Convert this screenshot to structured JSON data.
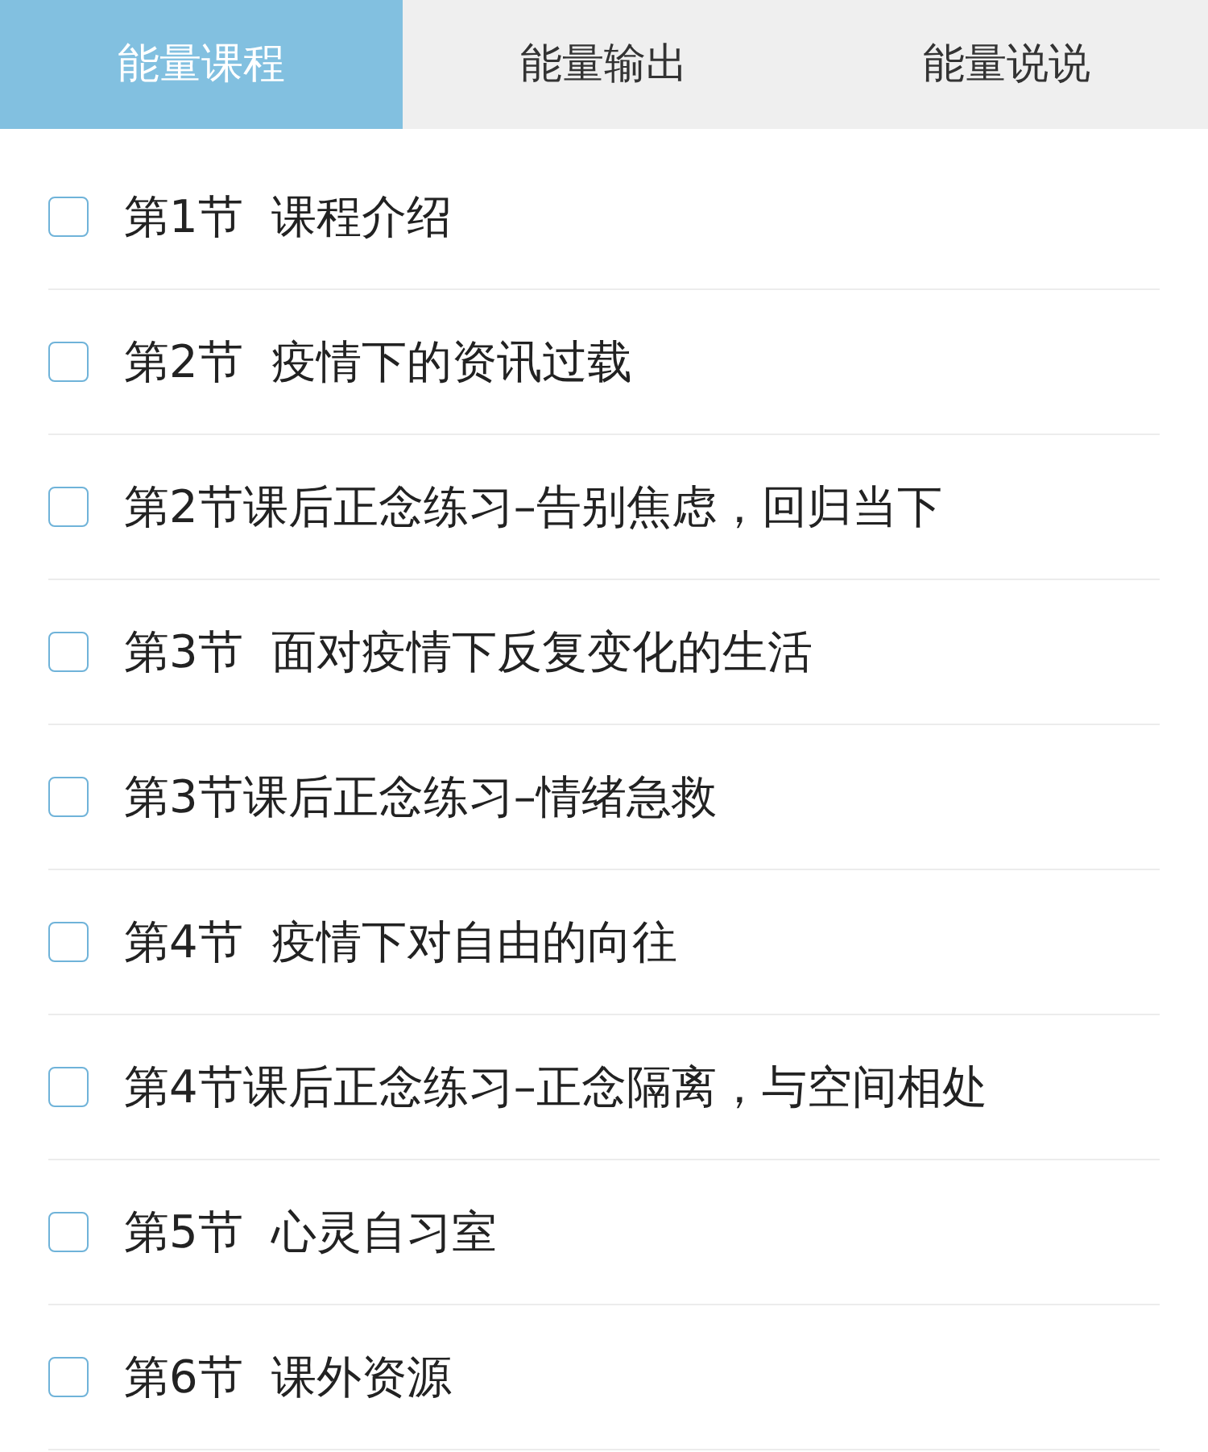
{
  "tabs": [
    {
      "label": "能量课程",
      "selected": true
    },
    {
      "label": "能量输出",
      "selected": false
    },
    {
      "label": "能量说说",
      "selected": false
    }
  ],
  "items": [
    {
      "label": "第1节  课程介绍",
      "checked": false
    },
    {
      "label": "第2节  疫情下的资讯过载",
      "checked": false
    },
    {
      "label": "第2节课后正念练习–告别焦虑，回归当下",
      "checked": false
    },
    {
      "label": "第3节  面对疫情下反复变化的生活",
      "checked": false
    },
    {
      "label": "第3节课后正念练习–情绪急救",
      "checked": false
    },
    {
      "label": "第4节  疫情下对自由的向往",
      "checked": false
    },
    {
      "label": "第4节课后正念练习–正念隔离，与空间相处",
      "checked": false
    },
    {
      "label": "第5节  心灵自习室",
      "checked": false
    },
    {
      "label": "第6节  课外资源",
      "checked": false
    }
  ]
}
